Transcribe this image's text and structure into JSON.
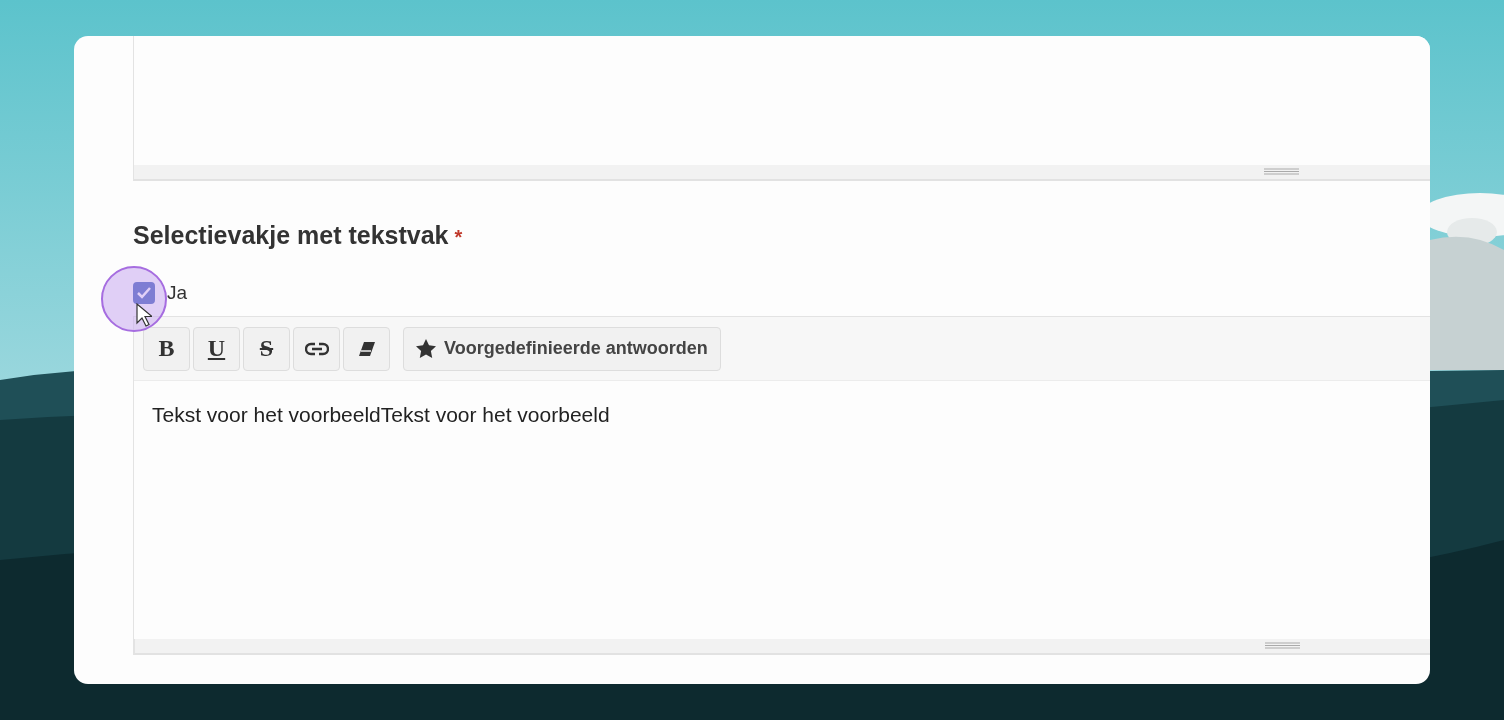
{
  "question": {
    "label": "Selectievakje met tekstvak",
    "required_mark": "*"
  },
  "checkbox": {
    "label": "Ja",
    "checked": true
  },
  "toolbar": {
    "buttons": [
      {
        "kind": "bold",
        "label": "B"
      },
      {
        "kind": "underline",
        "label": "U"
      },
      {
        "kind": "strike",
        "label": "S"
      },
      {
        "kind": "link"
      },
      {
        "kind": "eraser"
      },
      {
        "kind": "preset",
        "label": "Voorgedefinieerde antwoorden"
      }
    ]
  },
  "editor": {
    "value": "Tekst voor het voorbeeldTekst voor het voorbeeld"
  }
}
